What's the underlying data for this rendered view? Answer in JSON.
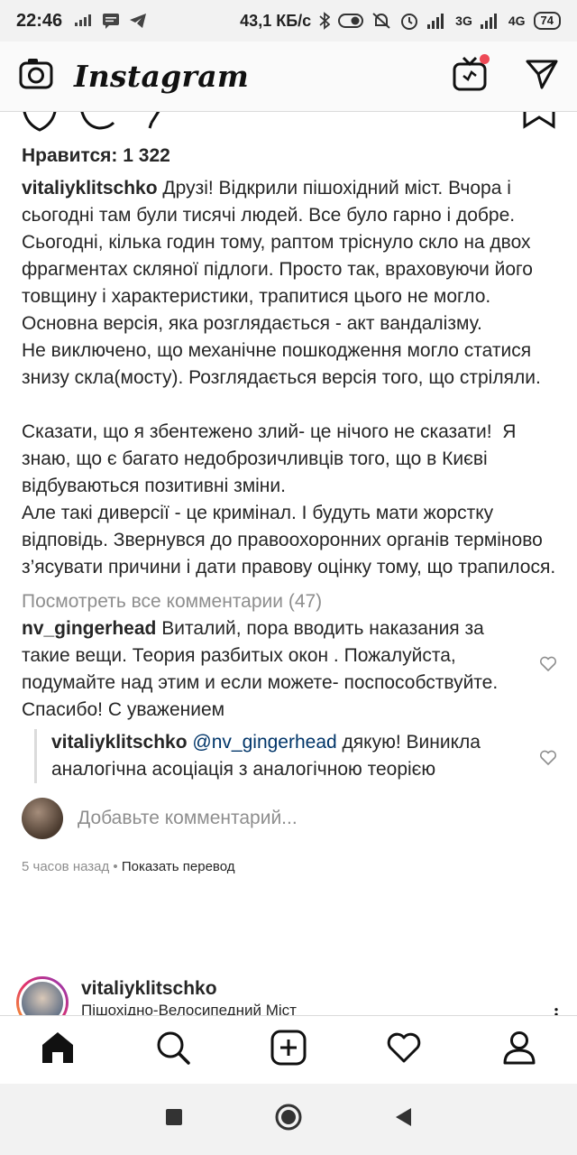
{
  "status_bar": {
    "time": "22:46",
    "speed": "43,1 КБ/с",
    "net_3g": "3G",
    "net_4g": "4G",
    "battery": "74"
  },
  "app": {
    "title": "Instagram"
  },
  "post": {
    "likes": "Нравится: 1 322",
    "author": "vitaliyklitschko",
    "caption": " Друзі! Відкрили пішохідний міст. Вчора і сьогодні там були тисячі людей. Все було гарно і добре. Сьогодні, кілька годин тому, раптом тріснуло скло на двох фрагментах скляної підлоги. Просто так, враховуючи його товщину і характеристики, трапитися цього не могло. Основна версія, яка розглядається - акт вандалізму.\nНе виключено, що механічне пошкодження могло статися знизу скла(мосту). Розглядається версія того, що стріляли.\n\nСказати, що я збентежено злий- це нічого не сказати!  Я знаю, що є багато недоброзичливців того, що в Києві відбуваються позитивні зміни.\nАле такі диверсії - це кримінал. І будуть мати жорстку відповідь. Звернувся до правоохоронних органів терміново з’ясувати причини і дати правову оцінку тому, що трапилося.",
    "view_all_comments": "Посмотреть все комментарии (47)",
    "comments": [
      {
        "user": "nv_gingerhead",
        "text": " Виталий, пора вводить наказания за такие вещи. Теория разбитых окон . Пожалуйста, подумайте над этим и если можете- поспособствуйте. Спасибо! С уважением"
      }
    ],
    "reply": {
      "user": "vitaliyklitschko",
      "mention": "@nv_gingerhead",
      "text": " дякую! Виникла аналогічна асоціація з аналогічною теорією"
    },
    "add_comment_placeholder": "Добавьте комментарий...",
    "time_ago": "5 часов назад",
    "separator": " • ",
    "show_translation": "Показать перевод"
  },
  "next_post": {
    "author": "vitaliyklitschko",
    "location": "Пішохідно-Велосипедний Міст"
  },
  "icons": {
    "camera": "camera-icon",
    "igtv": "igtv-icon",
    "direct": "direct-message-icon",
    "home": "home-icon",
    "search": "search-icon",
    "add": "add-post-icon",
    "activity": "heart-icon",
    "profile": "profile-icon"
  },
  "colors": {
    "notification_dot": "#ed4956",
    "muted_text": "#8e8e8e",
    "mention": "#003569"
  }
}
